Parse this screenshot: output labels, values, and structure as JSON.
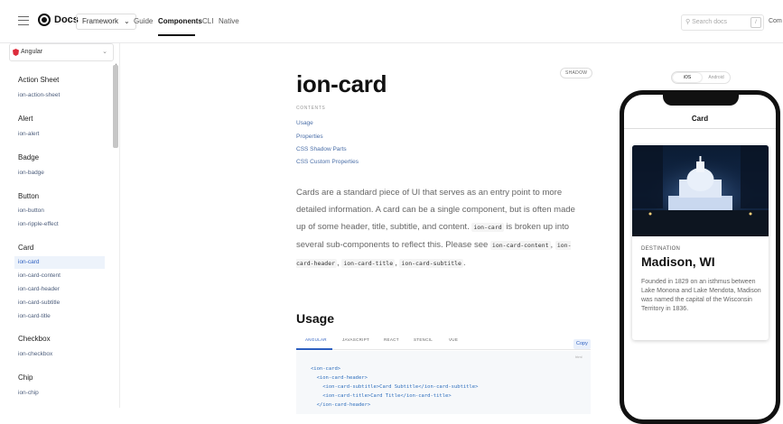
{
  "topbar": {
    "logo_text": "Docs",
    "framework_label": "Framework",
    "nav": [
      "Guide",
      "Components",
      "CLI",
      "Native"
    ],
    "search_placeholder": "Search docs",
    "search_key": "/",
    "right_link": "Com"
  },
  "sidebar": {
    "platform": "Angular",
    "groups": [
      {
        "title": "Action Sheet",
        "items": [
          "ion-action-sheet"
        ]
      },
      {
        "title": "Alert",
        "items": [
          "ion-alert"
        ]
      },
      {
        "title": "Badge",
        "items": [
          "ion-badge"
        ]
      },
      {
        "title": "Button",
        "items": [
          "ion-button",
          "ion-ripple-effect"
        ]
      },
      {
        "title": "Card",
        "items": [
          "ion-card",
          "ion-card-content",
          "ion-card-header",
          "ion-card-subtitle",
          "ion-card-title"
        ]
      },
      {
        "title": "Checkbox",
        "items": [
          "ion-checkbox"
        ]
      },
      {
        "title": "Chip",
        "items": [
          "ion-chip"
        ]
      }
    ]
  },
  "main": {
    "title": "ion-card",
    "shadow_badge": "SHADOW",
    "contents_label": "CONTENTS",
    "toc": [
      "Usage",
      "Properties",
      "CSS Shadow Parts",
      "CSS Custom Properties"
    ],
    "intro": {
      "text1": "Cards are a standard piece of UI that serves as an entry point to more detailed information. A card can be a single component, but is often made up of some header, title, subtitle, and content.",
      "code1": "ion-card",
      "text2": "is broken up into several sub-components to reflect this. Please see",
      "code2": "ion-card-content",
      "sep1": ",",
      "code3": "ion-card-header",
      "sep2": ",",
      "code4": "ion-card-title",
      "sep3": ",",
      "code5": "ion-card-subtitle",
      "end": "."
    },
    "usage_title": "Usage",
    "code_tabs": [
      "ANGULAR",
      "JAVASCRIPT",
      "REACT",
      "STENCIL",
      "VUE"
    ],
    "copy_label": "Copy",
    "code_lang": "html",
    "code_lines": [
      "<ion-card>",
      "  <ion-card-header>",
      "    <ion-card-subtitle>Card Subtitle</ion-card-subtitle>",
      "    <ion-card-title>Card Title</ion-card-title>",
      "  </ion-card-header>"
    ]
  },
  "preview": {
    "modes": [
      "iOS",
      "Android"
    ],
    "header_title": "Card",
    "card": {
      "subtitle": "DESTINATION",
      "title": "Madison, WI",
      "content": "Founded in 1829 on an isthmus between Lake Monona and Lake Mendota, Madison was named the capital of the Wisconsin Territory in 1836."
    }
  },
  "colors": {
    "accent": "#2d5fc0",
    "angular": "#dd2c3c"
  }
}
